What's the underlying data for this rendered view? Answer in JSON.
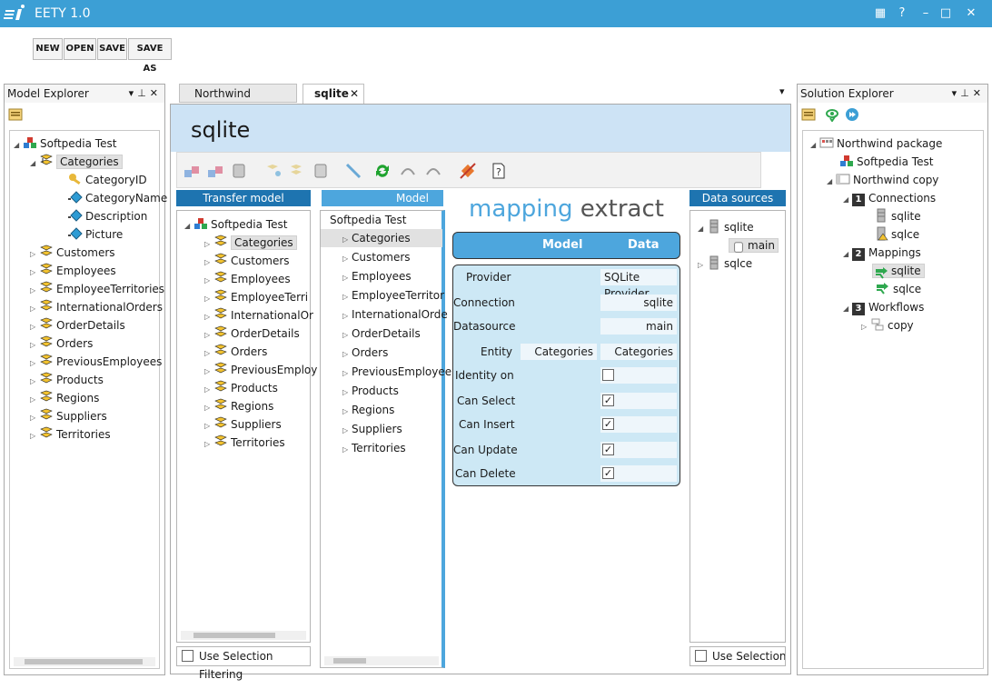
{
  "app": {
    "title": "EETY 1.0"
  },
  "toolbar": {
    "new": "NEW",
    "open": "OPEN",
    "save": "SAVE",
    "save_as": "SAVE AS"
  },
  "model_explorer": {
    "title": "Model Explorer",
    "root": "Softpedia Test",
    "selected": "Categories",
    "children": [
      "CategoryID",
      "CategoryName",
      "Description",
      "Picture"
    ],
    "tables": [
      "Customers",
      "Employees",
      "EmployeeTerritories",
      "InternationalOrders",
      "OrderDetails",
      "Orders",
      "PreviousEmployees",
      "Products",
      "Regions",
      "Suppliers",
      "Territories"
    ]
  },
  "tabs": {
    "tab1": "Northwind package",
    "tab2": "sqlite"
  },
  "doc": {
    "title": "sqlite"
  },
  "transfer_model": {
    "header": "Transfer model",
    "root": "Softpedia Test",
    "items": [
      "Categories",
      "Customers",
      "Employees",
      "EmployeeTerri",
      "InternationalOr",
      "OrderDetails",
      "Orders",
      "PreviousEmploy",
      "Products",
      "Regions",
      "Suppliers",
      "Territories"
    ],
    "filter": "Use Selection Filtering"
  },
  "model_col": {
    "header": "Model",
    "root": "Softpedia Test",
    "items": [
      "Categories",
      "Customers",
      "Employees",
      "EmployeeTerritor",
      "InternationalOrde",
      "OrderDetails",
      "Orders",
      "PreviousEmployee",
      "Products",
      "Regions",
      "Suppliers",
      "Territories"
    ]
  },
  "mapping": {
    "word1": "mapping",
    "word2": "extract",
    "col_model": "Model",
    "col_data": "Data",
    "provider_label": "Provider",
    "provider_value": "SQLite Provider",
    "connection_label": "Connection",
    "connection_value": "sqlite",
    "datasource_label": "Datasource",
    "datasource_value": "main",
    "entity_label": "Entity",
    "entity_model": "Categories",
    "entity_data": "Categories",
    "identity_label": "Identity on",
    "select_label": "Can Select",
    "insert_label": "Can Insert",
    "update_label": "Can Update",
    "delete_label": "Can Delete",
    "check_mark": "✓"
  },
  "data_sources": {
    "header": "Data sources",
    "item1": "sqlite",
    "item1_child": "main",
    "item2": "sqlce",
    "filter": "Use Selection F"
  },
  "solution_explorer": {
    "title": "Solution Explorer",
    "root": "Northwind package",
    "softpedia": "Softpedia Test",
    "copy": "Northwind copy",
    "connections": "Connections",
    "conn_num": "1",
    "conn1": "sqlite",
    "conn2": "sqlce",
    "mappings": "Mappings",
    "map_num": "2",
    "map1": "sqlite",
    "map2": "sqlce",
    "workflows": "Workflows",
    "wf_num": "3",
    "wf1": "copy"
  },
  "colors": {
    "titlebar": "#3c9fd5",
    "header_blue": "#1e74b0",
    "light_blue": "#cde8f5"
  }
}
